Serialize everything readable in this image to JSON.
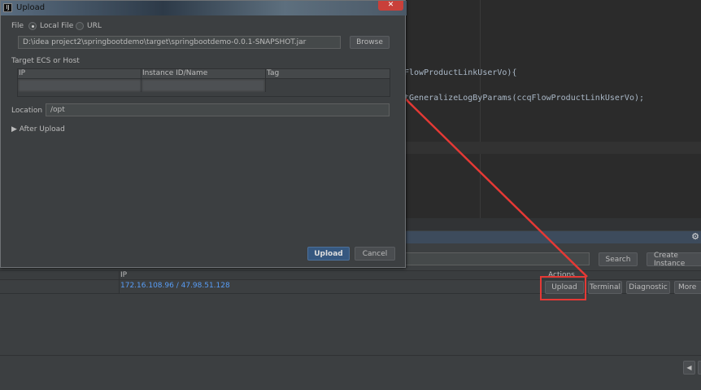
{
  "editor": {
    "code_lines": [
      "FlowProductLinkUserVo){",
      "tGeneralizeLogByParams(ccqFlowProductLinkUserVo);"
    ]
  },
  "panel": {
    "search_button": "Search",
    "create_instance_button": "Create Instance",
    "columns": {
      "ip": "IP",
      "actions": "Actions"
    },
    "rows": [
      {
        "ip": "172.16.108.96 / 47.98.51.128",
        "actions": [
          "Upload",
          "Terminal",
          "Diagnostic",
          "More"
        ]
      }
    ]
  },
  "dialog": {
    "title": "Upload",
    "file_label": "File",
    "local_file_label": "Local File",
    "url_label": "URL",
    "selected_source": "Local File",
    "file_path": "D:\\idea project2\\springbootdemo\\target\\springbootdemo-0.0.1-SNAPSHOT.jar",
    "browse_button": "Browse",
    "target_label": "Target ECS or Host",
    "table_columns": [
      "IP",
      "Instance ID/Name",
      "Tag"
    ],
    "location_label": "Location",
    "location_value": "/opt",
    "after_upload_label": "After Upload",
    "upload_button": "Upload",
    "cancel_button": "Cancel"
  },
  "colors": {
    "annotation": "#e53935",
    "link": "#589df6",
    "primary_button": "#365880"
  }
}
